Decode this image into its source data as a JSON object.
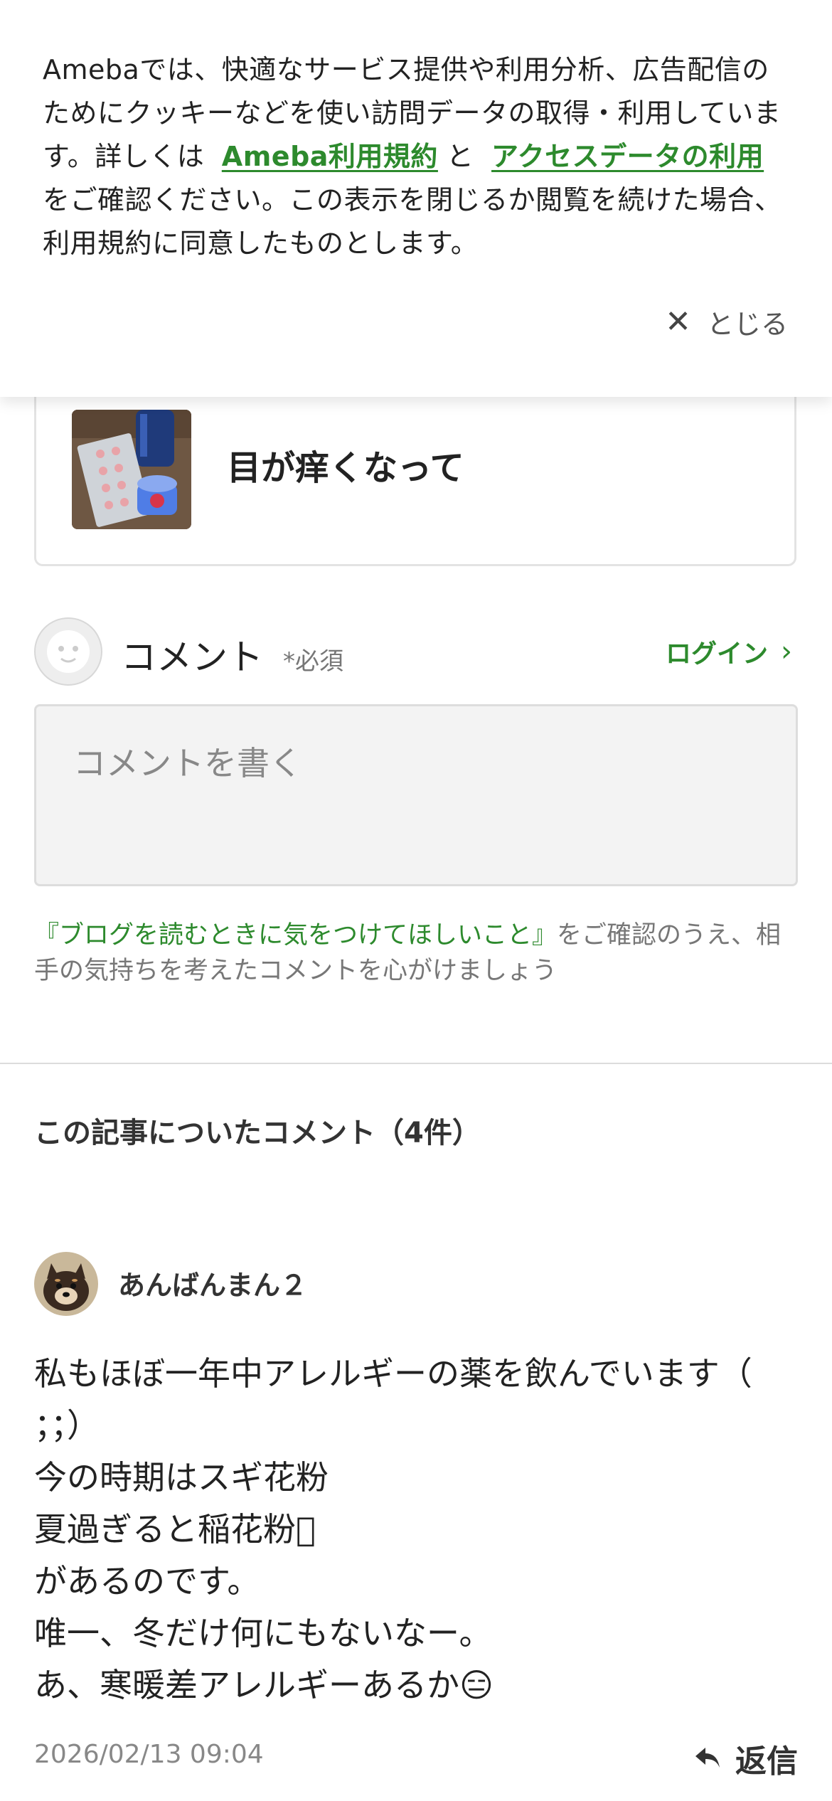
{
  "cookie_banner": {
    "text_before": "Amebaでは、快適なサービス提供や利用分析、広告配信のためにクッキーなどを使い訪問データの取得・利用しています。詳しくは",
    "link_terms": "Ameba利用規約",
    "conjunction": "と",
    "link_access": "アクセスデータの利用",
    "text_after": "をご確認ください。この表示を閉じるか閲覧を続けた場合、利用規約に同意したものとします。",
    "close_label": "とじる"
  },
  "article_card": {
    "title": "目が痒くなって"
  },
  "comment_form": {
    "heading": "コメント",
    "required": "*必須",
    "login_label": "ログイン",
    "placeholder": "コメントを書く",
    "guideline_link": "『ブログを読むときに気をつけてほしいこと』",
    "guideline_text": "をご確認のうえ、相手の気持ちを考えたコメントを心がけましょう"
  },
  "comments": {
    "heading": "この記事についたコメント（4件）",
    "items": [
      {
        "author": "あんばんまん２",
        "lines": [
          "私もほぼ一年中アレルギーの薬を飲んでいます（",
          "；；）",
          "今の時期はスギ花粉",
          "夏過ぎると稲花粉󾬆",
          "があるのです。",
          "唯一、冬だけ何にもないなー。",
          "あ、寒暖差アレルギーあるか😑"
        ],
        "date": "2026/02/13 09:04",
        "reply_label": "返信"
      }
    ]
  },
  "colors": {
    "accent_green": "#2d8a2d",
    "text_main": "#222222",
    "text_muted": "#888888"
  },
  "icons": {
    "close": "close-icon",
    "chevron": "chevron-right-icon",
    "reply": "reply-arrow-icon"
  }
}
